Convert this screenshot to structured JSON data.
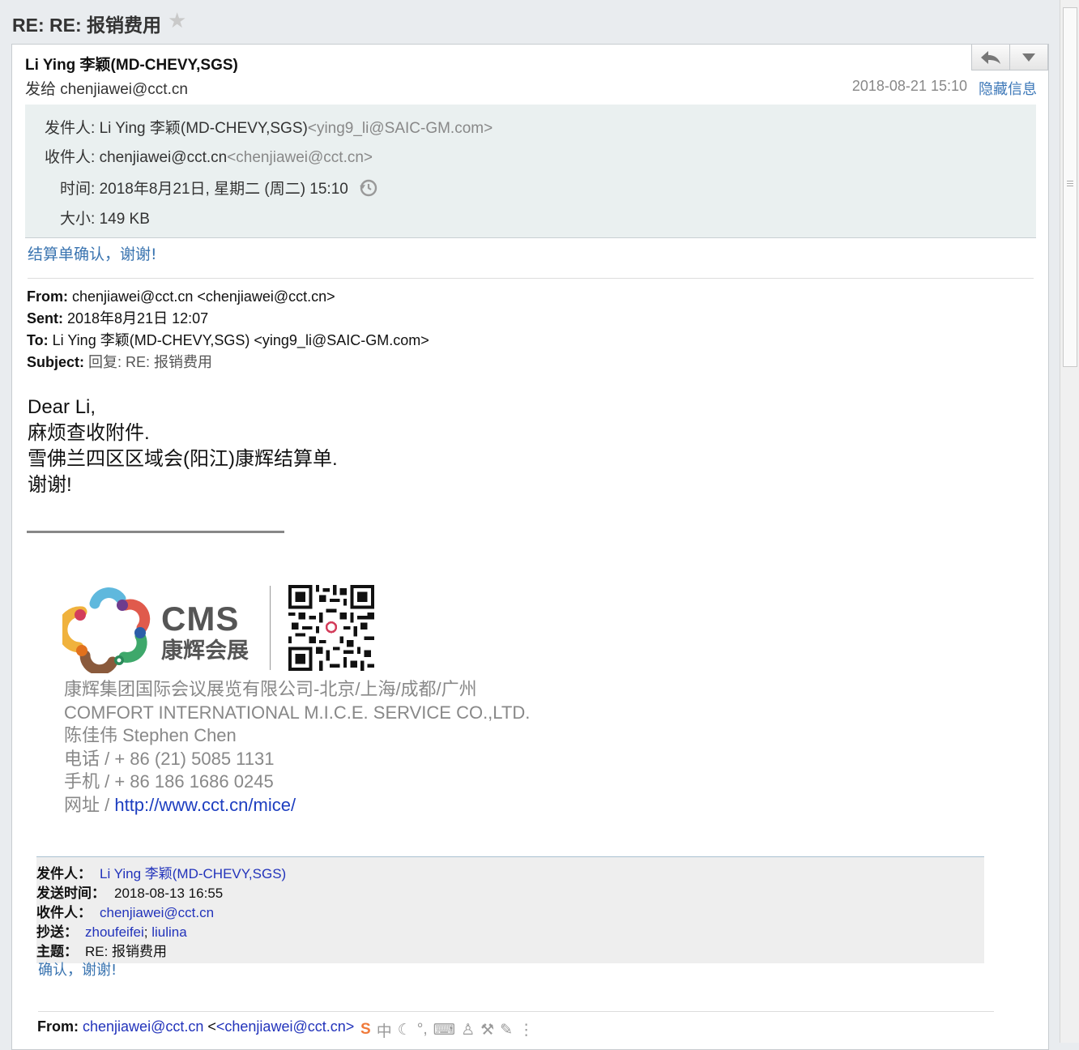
{
  "subject": {
    "title": "RE: RE: 报销费用",
    "star_icon": "star-icon"
  },
  "header": {
    "sender": "Li Ying 李颖(MD-CHEVY,SGS)",
    "send_to": "发给 chenjiawei@cct.cn",
    "datetime": "2018-08-21 15:10",
    "hide_info": "隐藏信息",
    "reply_icon": "reply-icon",
    "more_icon": "chevron-down-icon"
  },
  "meta": {
    "from_label": "发件人: ",
    "from_name": "Li Ying 李颖(MD-CHEVY,SGS)",
    "from_email": "<ying9_li@SAIC-GM.com>",
    "to_label": "收件人: ",
    "to_name": "chenjiawei@cct.cn",
    "to_email": "<chenjiawei@cct.cn>",
    "time_label": "时间: ",
    "time_value": "2018年8月21日, 星期二 (周二) 15:10",
    "size_label": "大小: ",
    "size_value": "149 KB"
  },
  "reply_text": "结算单确认，谢谢!",
  "original": {
    "from_label": "From:",
    "from_value": " chenjiawei@cct.cn <chenjiawei@cct.cn>",
    "sent_label": "Sent:",
    "sent_value": " 2018年8月21日 12:07",
    "to_label": "To:",
    "to_value": " Li Ying 李颖(MD-CHEVY,SGS) <ying9_li@SAIC-GM.com>",
    "subject_label": "Subject:",
    "subject_value": " 回复: RE: 报销费用"
  },
  "body": {
    "greeting": "Dear Li,",
    "line1": "麻烦查收附件.",
    "line2": "雪佛兰四区区域会(阳江)康辉结算单.",
    "line3": "谢谢!"
  },
  "logo": {
    "name": "CMS",
    "subtitle": "康辉会展"
  },
  "signature": {
    "company_cn": "康辉集团国际会议展览有限公司-北京/上海/成都/广州",
    "company_en": "COMFORT INTERNATIONAL M.I.C.E. SERVICE CO.,LTD.",
    "person": "陈佳伟 Stephen Chen",
    "phone": "电话 / + 86 (21) 5085 1131",
    "mobile": "手机 / + 86 186 1686 0245",
    "website_label": "网址 / ",
    "website_url": "http://www.cct.cn/mice/"
  },
  "forwarded": {
    "from_label": "发件人：",
    "from_value": "Li Ying 李颖(MD-CHEVY,SGS)",
    "sent_label": "发送时间：",
    "sent_value": "2018-08-13 16:55",
    "to_label": "收件人：",
    "to_value": "chenjiawei@cct.cn",
    "cc_label": "抄送：",
    "cc_value1": "zhoufeifei",
    "cc_sep": ";",
    "cc_value2": "liulina",
    "subject_label": "主题：",
    "subject_value": "RE: 报销费用",
    "reply_text": "确认，谢谢!"
  },
  "second_original": {
    "from_label": "From:",
    "from_email": "chenjiawei@cct.cn",
    "from_bracket_email": "<chenjiawei@cct.cn>"
  },
  "ime_toolbar": {
    "logo": "S",
    "mode": "中",
    "icons": [
      "moon-icon",
      "punctuation-icon",
      "keyboard-icon",
      "user-icon",
      "wrench-icon",
      "edit-icon",
      "more-icon"
    ]
  }
}
